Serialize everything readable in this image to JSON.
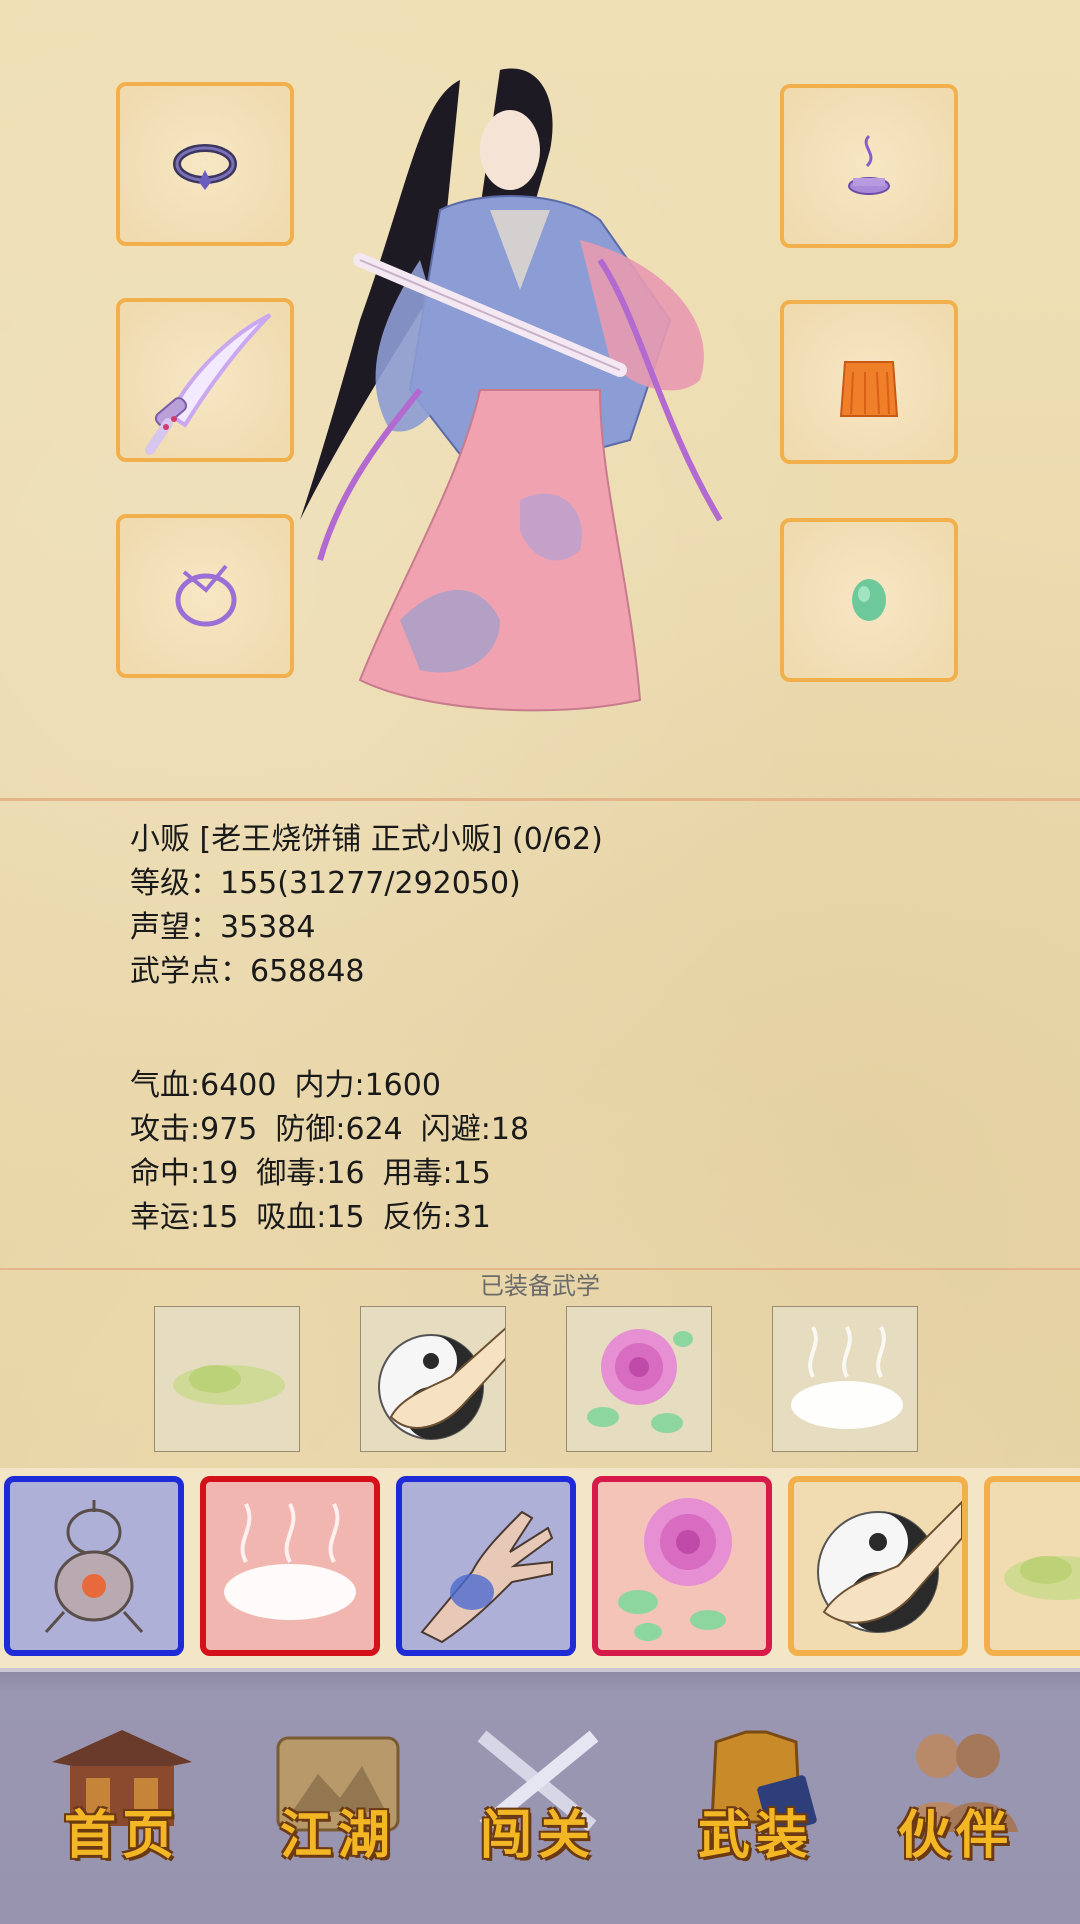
{
  "equipment": {
    "left": [
      "ring-icon",
      "sword-icon",
      "bracelet-icon"
    ],
    "right": [
      "incense-icon",
      "robe-icon",
      "jade-icon"
    ]
  },
  "profile": {
    "title_line": "小贩 [老王烧饼铺 正式小贩] (0/62)",
    "level_line": "等级：155(31277/292050)",
    "fame_line": "声望：35384",
    "martial_points_line": "武学点：658848"
  },
  "stats": {
    "hp": "气血:6400",
    "mp": "内力:1600",
    "attack": "攻击:975",
    "defense": "防御:624",
    "dodge": "闪避:18",
    "hit": "命中:19",
    "poison_resist": "御毒:16",
    "poison_use": "用毒:15",
    "luck": "幸运:15",
    "lifesteal": "吸血:15",
    "reflect": "反伤:31"
  },
  "equipped_martial": {
    "title": "已装备武学",
    "skills": [
      "cloud-skill-icon",
      "taiji-palm-icon",
      "rose-skill-icon",
      "mist-skill-icon"
    ]
  },
  "skill_bar": [
    {
      "icon": "furnace-skill-icon",
      "border": "#1f2bd6",
      "bg": "#aeb0d8"
    },
    {
      "icon": "mist-skill-icon",
      "border": "#d4101a",
      "bg": "#f2b6b0"
    },
    {
      "icon": "claw-hand-icon",
      "border": "#1f2bd6",
      "bg": "#aeb0d8"
    },
    {
      "icon": "rose-skill-icon",
      "border": "#d61a4a",
      "bg": "#f4c4b8"
    },
    {
      "icon": "taiji-palm-icon",
      "border": "#f2b04d",
      "bg": "#f1dbb0"
    },
    {
      "icon": "cloud-skill-icon",
      "border": "#f2b04d",
      "bg": "#f1dbb0"
    }
  ],
  "nav": {
    "home": "首页",
    "jianghu": "江湖",
    "chuangguan": "闯关",
    "wuzhuang": "武装",
    "huoban": "伙伴"
  }
}
